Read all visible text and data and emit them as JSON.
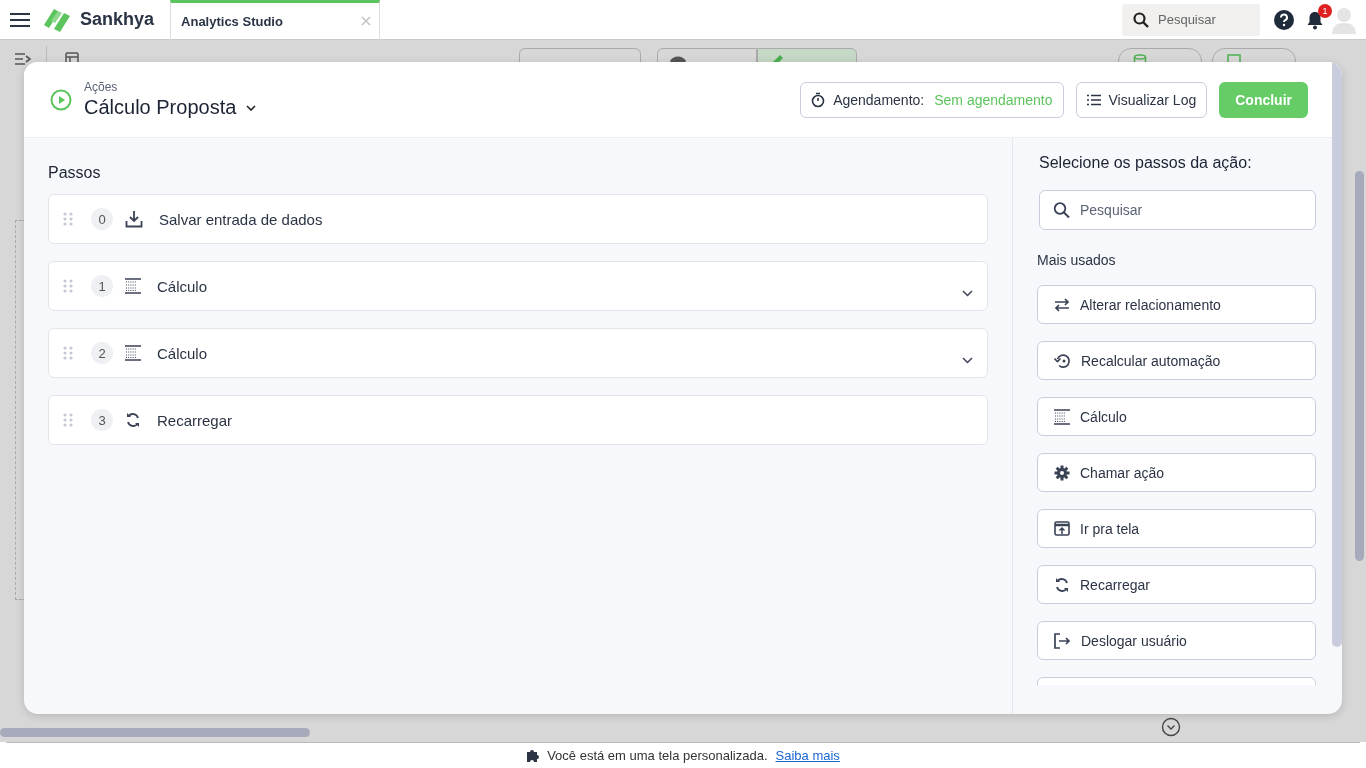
{
  "header": {
    "app_name": "Sankhya",
    "tab": {
      "label": "Analytics Studio",
      "selected": true
    },
    "search": {
      "placeholder": "Pesquisar"
    },
    "notifications": "1"
  },
  "toolbar": {
    "modes": [
      {
        "selected": false,
        "kind": "eye"
      },
      {
        "selected": true,
        "kind": "pencil"
      }
    ],
    "buttons": [
      {
        "kind": "database"
      },
      {
        "kind": "image"
      }
    ]
  },
  "modal": {
    "breadcrumb": "Ações",
    "title": "Cálculo Proposta",
    "schedule_label": "Agendamento:",
    "schedule_value": "Sem agendamento",
    "log_button": "Visualizar Log",
    "confirm_button": "Concluir",
    "steps_title": "Passos",
    "steps": [
      {
        "index": "0",
        "kind": "download",
        "label": "Salvar entrada de dados",
        "expandable": false
      },
      {
        "index": "1",
        "kind": "calc",
        "label": "Cálculo",
        "expandable": true
      },
      {
        "index": "2",
        "kind": "calc",
        "label": "Cálculo",
        "expandable": true
      },
      {
        "index": "3",
        "kind": "reload",
        "label": "Recarregar",
        "expandable": false
      }
    ],
    "picker_title": "Selecione os passos da ação:",
    "picker_search": {
      "placeholder": "Pesquisar"
    },
    "section_title": "Mais usados",
    "options": [
      {
        "kind": "swap",
        "label": "Alterar relacionamento"
      },
      {
        "kind": "recalc",
        "label": "Recalcular automação"
      },
      {
        "kind": "calc",
        "label": "Cálculo"
      },
      {
        "kind": "gear",
        "label": "Chamar ação"
      },
      {
        "kind": "screen",
        "label": "Ir pra tela"
      },
      {
        "kind": "reload",
        "label": "Recarregar"
      },
      {
        "kind": "logout",
        "label": "Deslogar usuário"
      }
    ]
  },
  "footer": {
    "text": "Você está em uma tela personalizada.",
    "link": "Saiba mais"
  }
}
